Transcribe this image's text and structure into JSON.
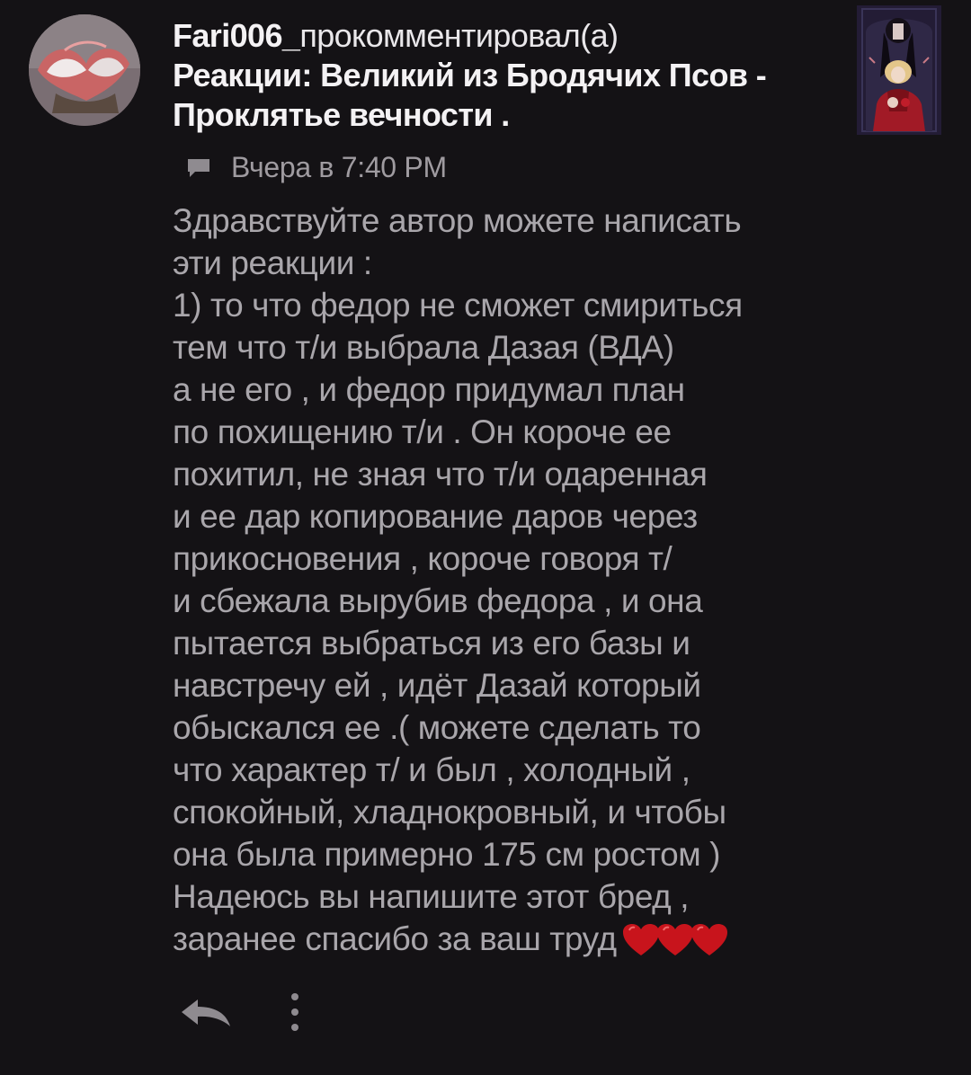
{
  "notification": {
    "username": "Fari006_",
    "action": "прокомментировал(а)",
    "story_title_line1": "Реакции: Великий из Бродячих Псов -",
    "story_title_line2": "Проклятье вечности .",
    "timestamp": "Вчера в 7:40 PM",
    "comment_icon": "comment-icon",
    "comment_lines": [
      "Здравствуйте автор можете написать",
      "эти реакции :",
      "1) то что федор не сможет смириться",
      "тем что т/и выбрала Дазая (ВДА)",
      "а не его , и федор придумал план",
      "по похищению т/и . Он короче ее",
      "похитил, не зная что т/и одаренная",
      "и ее дар копирование даров через",
      "прикосновения , короче говоря т/",
      "и сбежала вырубив федора , и она",
      "пытается выбраться из его базы и",
      "навстречу ей , идёт Дазай который",
      "обыскался ее .( можете сделать то",
      "что характер т/ и был , холодный ,",
      "спокойный, хладнокровный, и чтобы",
      "она была примерно 175 см ростом )",
      "Надеюсь вы напишите этот бред ,",
      "заранее спасибо за ваш труд"
    ],
    "hearts_icon": "red-hearts-emoji",
    "reply_icon": "reply-icon",
    "more_icon": "more-vertical-icon"
  },
  "colors": {
    "background": "#141215",
    "title_text": "#f4f2f4",
    "body_text": "#a9a6ab",
    "meta_text": "#9f9ba0",
    "heart": "#c8141c"
  }
}
